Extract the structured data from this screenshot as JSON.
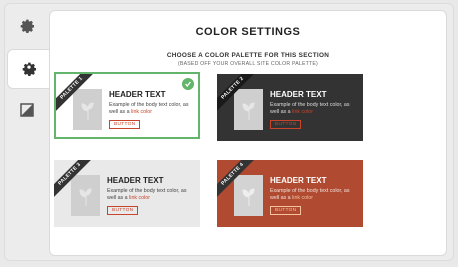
{
  "header": {
    "title": "COLOR SETTINGS",
    "subtitle": "CHOOSE A COLOR PALETTE FOR THIS SECTION",
    "note": "(BASED OFF YOUR OVERALL SITE COLOR PALETTE)"
  },
  "sidebar": {
    "items": [
      {
        "icon": "gear-icon",
        "active": false
      },
      {
        "icon": "gear-icon",
        "active": true
      },
      {
        "icon": "contrast-icon",
        "active": false
      }
    ]
  },
  "palettes": [
    {
      "ribbon": "PALETTE 1",
      "header": "HEADER TEXT",
      "body": "Example of the body text color, as well as a",
      "link": "link color",
      "button": "BUTTON",
      "selected": true,
      "background": "#ffffff"
    },
    {
      "ribbon": "PALETTE 2",
      "header": "HEADER TEXT",
      "body": "Example of the body text color, as well as a",
      "link": "link color",
      "button": "BUTTON",
      "selected": false,
      "background": "#333333"
    },
    {
      "ribbon": "PALETTE 3",
      "header": "HEADER TEXT",
      "body": "Example of the body text color, as well as a",
      "link": "link color",
      "button": "BUTTON",
      "selected": false,
      "background": "#e9e9e9"
    },
    {
      "ribbon": "PALETTE 4",
      "header": "HEADER TEXT",
      "body": "Example of the body text color, as well as a",
      "link": "link color",
      "button": "BUTTON",
      "selected": false,
      "background": "#b04a30"
    }
  ],
  "colors": {
    "selected_border": "#62b56a",
    "link": "#c7452a"
  }
}
